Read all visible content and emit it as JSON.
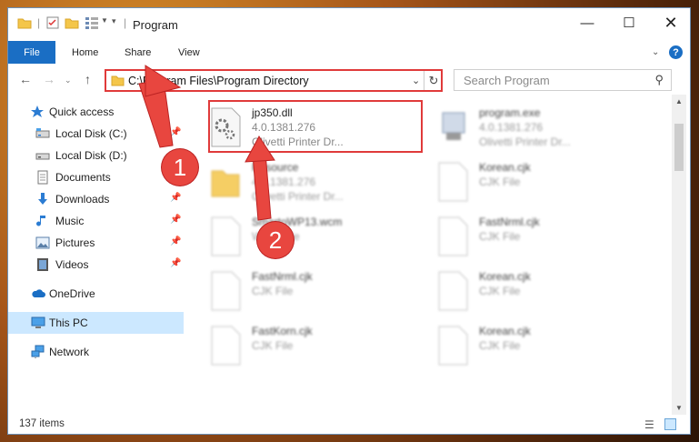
{
  "window": {
    "title": "Program",
    "controls": [
      "minimize",
      "maximize",
      "close"
    ]
  },
  "ribbon": {
    "tabs": [
      "File",
      "Home",
      "Share",
      "View"
    ]
  },
  "address": {
    "path": "C:\\Program Files\\Program Directory"
  },
  "search": {
    "placeholder": "Search Program"
  },
  "nav_pane": {
    "items": [
      {
        "label": "Quick access",
        "icon": "star-icon",
        "pinned": false
      },
      {
        "label": "Local Disk (C:)",
        "icon": "drive-icon",
        "pinned": true
      },
      {
        "label": "Local Disk (D:)",
        "icon": "drive-icon",
        "pinned": false
      },
      {
        "label": "Documents",
        "icon": "documents-icon",
        "pinned": true
      },
      {
        "label": "Downloads",
        "icon": "download-icon",
        "pinned": true
      },
      {
        "label": "Music",
        "icon": "music-icon",
        "pinned": true
      },
      {
        "label": "Pictures",
        "icon": "pictures-icon",
        "pinned": true
      },
      {
        "label": "Videos",
        "icon": "videos-icon",
        "pinned": true
      },
      {
        "label": "OneDrive",
        "icon": "cloud-icon",
        "pinned": false
      },
      {
        "label": "This PC",
        "icon": "computer-icon",
        "pinned": false,
        "selected": true
      },
      {
        "label": "Network",
        "icon": "network-icon",
        "pinned": false
      }
    ]
  },
  "files": [
    {
      "name": "jp350.dll",
      "line1": "4.0.1381.276",
      "line2": "Olivetti Printer Dr...",
      "icon": "dll-file-icon",
      "highlighted": true
    },
    {
      "name": "program.exe",
      "line1": "4.0.1381.276",
      "line2": "Olivetti Printer Dr...",
      "icon": "exe-file-icon"
    },
    {
      "name": "Resource",
      "line1": "4.0.1381.276",
      "line2": "Olivetti Printer Dr...",
      "icon": "folder-icon"
    },
    {
      "name": "Korean.cjk",
      "line1": "CJK File",
      "line2": "",
      "icon": "file-icon"
    },
    {
      "name": "SmartoWP13.wcm",
      "line1": "WCM File",
      "line2": "",
      "icon": "file-icon"
    },
    {
      "name": "FastNrml.cjk",
      "line1": "CJK File",
      "line2": "",
      "icon": "file-icon"
    },
    {
      "name": "FastNrml.cjk",
      "line1": "CJK File",
      "line2": "",
      "icon": "file-icon"
    },
    {
      "name": "Korean.cjk",
      "line1": "CJK File",
      "line2": "",
      "icon": "file-icon"
    },
    {
      "name": "FastKorn.cjk",
      "line1": "CJK File",
      "line2": "",
      "icon": "file-icon"
    },
    {
      "name": "Korean.cjk",
      "line1": "CJK File",
      "line2": "",
      "icon": "file-icon"
    }
  ],
  "status": {
    "count": "137 items"
  },
  "annotations": {
    "step1": "1",
    "step2": "2",
    "color": "#e8463f"
  }
}
